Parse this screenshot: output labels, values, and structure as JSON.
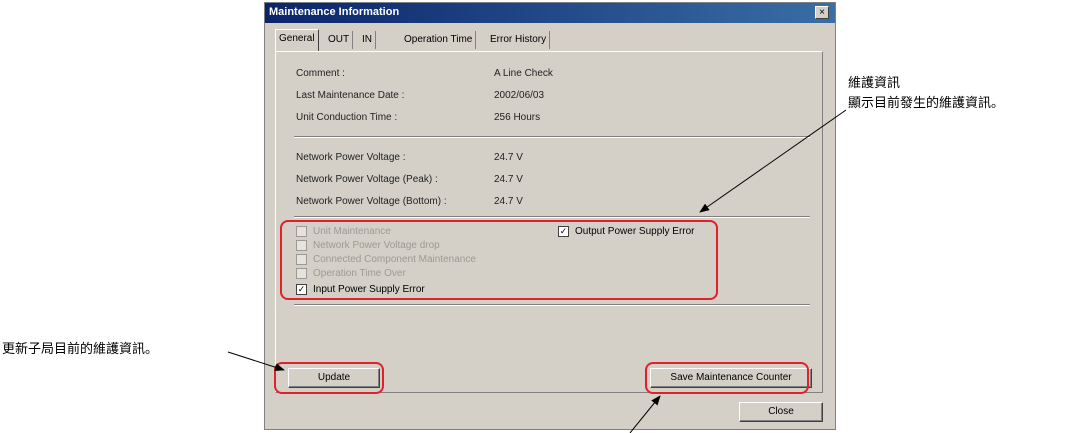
{
  "window": {
    "title": "Maintenance Information",
    "close_glyph": "×"
  },
  "tabs": [
    "General",
    "OUT",
    "IN",
    "Operation Time",
    "Error History"
  ],
  "info": {
    "rows": [
      {
        "label": "Comment :",
        "value": "A Line Check"
      },
      {
        "label": "Last Maintenance Date :",
        "value": "2002/06/03"
      },
      {
        "label": "Unit Conduction Time :",
        "value": "256 Hours"
      }
    ],
    "voltage_rows": [
      {
        "label": "Network Power Voltage :",
        "value": "24.7 V"
      },
      {
        "label": "Network Power Voltage (Peak) :",
        "value": "24.7 V"
      },
      {
        "label": "Network Power Voltage (Bottom) :",
        "value": "24.7 V"
      }
    ]
  },
  "checks": [
    {
      "label": "Unit Maintenance",
      "checked": false,
      "enabled": false
    },
    {
      "label": "Network Power Voltage drop",
      "checked": false,
      "enabled": false
    },
    {
      "label": "Connected Component Maintenance",
      "checked": false,
      "enabled": false
    },
    {
      "label": "Operation Time Over",
      "checked": false,
      "enabled": false
    },
    {
      "label": "Input Power Supply Error",
      "checked": true,
      "enabled": true
    },
    {
      "label": "Output Power Supply Error",
      "checked": true,
      "enabled": true
    }
  ],
  "check_mark": "✓",
  "buttons": {
    "update": "Update",
    "save_counter": "Save Maintenance Counter",
    "close": "Close"
  },
  "annotations": {
    "maint_title": "維護資訊",
    "maint_desc": "顯示目前發生的維護資訊。",
    "update_desc": "更新子局目前的維護資訊。"
  },
  "colors": {
    "highlight": "#e0202a",
    "titlebar": "#0a246a",
    "dialog": "#d4d0c8"
  }
}
